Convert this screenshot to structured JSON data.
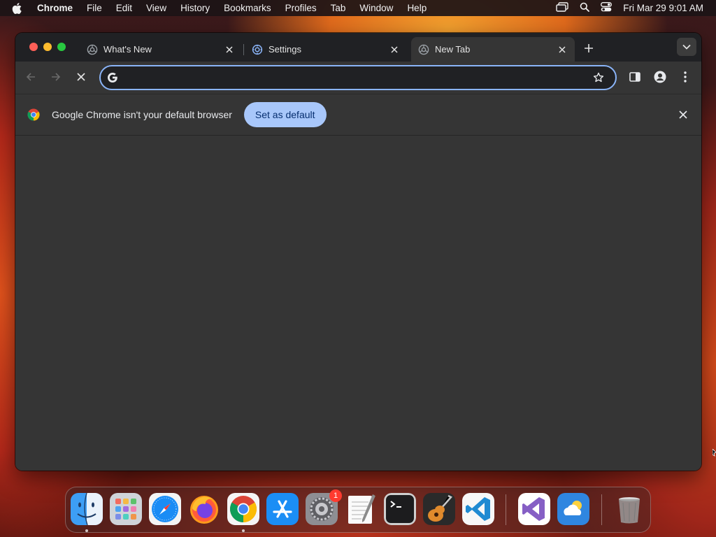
{
  "menubar": {
    "app_name": "Chrome",
    "menus": [
      "File",
      "Edit",
      "View",
      "History",
      "Bookmarks",
      "Profiles",
      "Tab",
      "Window",
      "Help"
    ],
    "clock": "Fri Mar 29  9:01 AM",
    "icons": [
      "apple-icon",
      "screen-mirroring-icon",
      "spotlight-search-icon",
      "control-center-icon"
    ]
  },
  "browser": {
    "tabs": [
      {
        "title": "What's New",
        "icon": "chrome-globe-icon",
        "active": false
      },
      {
        "title": "Settings",
        "icon": "settings-gear-icon",
        "active": false
      },
      {
        "title": "New Tab",
        "icon": "chrome-globe-icon",
        "active": true
      }
    ],
    "omnibox": {
      "value": "",
      "placeholder": ""
    },
    "infobar": {
      "message": "Google Chrome isn't your default browser",
      "button_label": "Set as default"
    }
  },
  "dock": {
    "apps": [
      {
        "name": "Finder",
        "icon": "finder-icon",
        "running": true
      },
      {
        "name": "Launchpad",
        "icon": "launchpad-icon",
        "running": false
      },
      {
        "name": "Safari",
        "icon": "safari-icon",
        "running": false
      },
      {
        "name": "Firefox",
        "icon": "firefox-icon",
        "running": false
      },
      {
        "name": "Google Chrome",
        "icon": "chrome-icon",
        "running": true
      },
      {
        "name": "App Store",
        "icon": "app-store-icon",
        "running": false
      },
      {
        "name": "System Preferences",
        "icon": "system-preferences-icon",
        "running": false,
        "badge": "1"
      },
      {
        "name": "TextEdit",
        "icon": "textedit-icon",
        "running": false
      },
      {
        "name": "Terminal",
        "icon": "terminal-icon",
        "running": false
      },
      {
        "name": "GarageBand",
        "icon": "garageband-icon",
        "running": false
      },
      {
        "name": "Visual Studio Code",
        "icon": "vscode-icon",
        "running": false
      },
      {
        "name": "Visual Studio",
        "icon": "visual-studio-icon",
        "running": false
      },
      {
        "name": "Weather",
        "icon": "weather-icon",
        "running": false
      },
      {
        "name": "Trash",
        "icon": "trash-icon",
        "running": false
      }
    ]
  },
  "colors": {
    "accent": "#8ab4f8",
    "button_bg": "#a8c7fa",
    "window_bg": "#353535",
    "tabstrip_bg": "#202124"
  }
}
